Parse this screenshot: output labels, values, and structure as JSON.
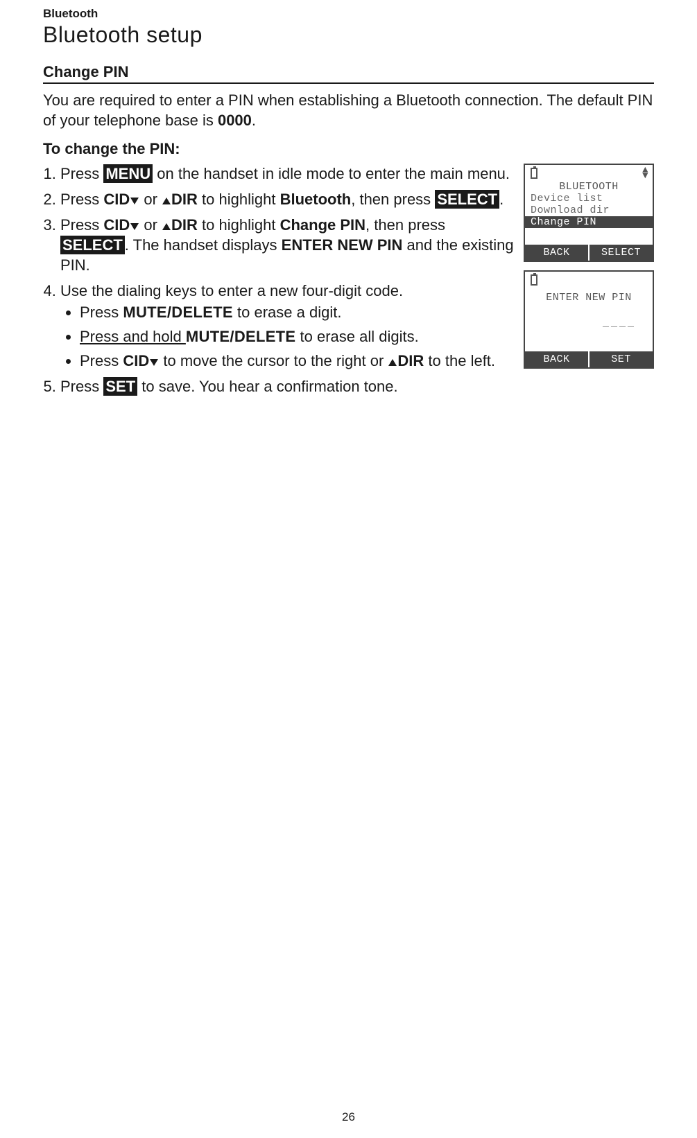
{
  "breadcrumb": "Bluetooth",
  "page_title": "Bluetooth setup",
  "section_heading": "Change PIN",
  "intro": {
    "line1": "You are required to enter a PIN when establishing a Bluetooth connection. The default PIN of your telephone base is ",
    "bold_pin": "0000",
    "tail": "."
  },
  "subhead": "To change the PIN:",
  "steps": {
    "s1_a": "Press ",
    "s1_btn": "MENU",
    "s1_b": " on the handset in idle mode to enter the main menu.",
    "s2_a": "Press ",
    "s2_cid": "CID",
    "s2_b": " or ",
    "s2_dir": "DIR",
    "s2_c": " to highlight ",
    "s2_bt": "Bluetooth",
    "s2_d": ", then press ",
    "s2_sel": "SELECT",
    "s2_e": ".",
    "s3_a": "Press ",
    "s3_cid": "CID",
    "s3_b": " or ",
    "s3_dir": "DIR",
    "s3_c": " to highlight ",
    "s3_cp": "Change PIN",
    "s3_d": ", then press ",
    "s3_sel": "SELECT",
    "s3_e": ". The handset displays ",
    "s3_enp": "ENTER NEW PIN",
    "s3_f": " and the existing PIN.",
    "s4": "Use the dialing keys to enter a new four-digit code.",
    "b1_a": "Press ",
    "b1_md": "MUTE/DELETE",
    "b1_b": " to erase a digit.",
    "b2_a": "Press and hold ",
    "b2_md": "MUTE/DELETE",
    "b2_b": " to erase all digits.",
    "b3_a": "Press ",
    "b3_cid": "CID",
    "b3_b": " to move the cursor to the right or ",
    "b3_dir": "DIR",
    "b3_c": " to the left.",
    "s5_a": "Press ",
    "s5_set": "SET",
    "s5_b": " to save. You hear a confirmation tone."
  },
  "lcd1": {
    "title": "BLUETOOTH",
    "line1": "Device list",
    "line2": "Download dir",
    "line3": "Change PIN",
    "sk_left": "BACK",
    "sk_right": "SELECT"
  },
  "lcd2": {
    "title": "ENTER NEW PIN",
    "placeholder": "____",
    "sk_left": "BACK",
    "sk_right": "SET"
  },
  "page_number": "26"
}
